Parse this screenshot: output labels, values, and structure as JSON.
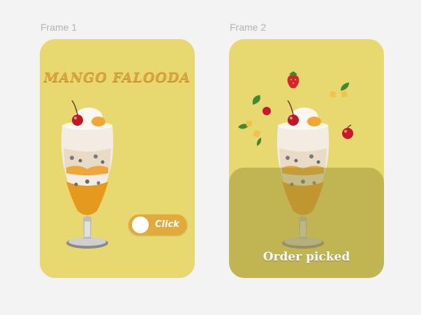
{
  "frames": [
    {
      "label": "Frame 1",
      "title": "MANGO FALOODA",
      "toggle_label": "Click"
    },
    {
      "label": "Frame 2",
      "overlay_text": "Order picked"
    }
  ],
  "colors": {
    "card_background": "#e7d96f",
    "title_color": "#d9a43a",
    "toggle_color": "#e2aa3c",
    "overlay_color": "#a0963c",
    "page_background": "#f3f3f3"
  },
  "icons": [
    "falooda-glass-icon",
    "strawberry-icon",
    "cherry-icon",
    "mint-leaf-icon",
    "mango-cube-icon"
  ]
}
